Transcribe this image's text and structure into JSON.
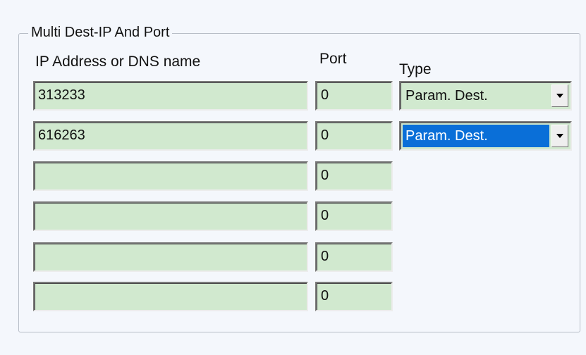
{
  "group": {
    "title": "Multi Dest-IP And Port"
  },
  "headers": {
    "ip": "IP Address or DNS name",
    "port": "Port",
    "type": "Type"
  },
  "rows": [
    {
      "ip": "313233",
      "port": "0",
      "type": "Param. Dest."
    },
    {
      "ip": "616263",
      "port": "0",
      "type": "Param. Dest."
    },
    {
      "ip": "",
      "port": "0"
    },
    {
      "ip": "",
      "port": "0"
    },
    {
      "ip": "",
      "port": "0"
    },
    {
      "ip": "",
      "port": "0"
    }
  ],
  "colors": {
    "field_background": "#d1e9cf",
    "selection": "#0a6fd8",
    "page_background": "#f4f7fc"
  },
  "icons": {
    "dropdown": "chevron-down-icon"
  }
}
